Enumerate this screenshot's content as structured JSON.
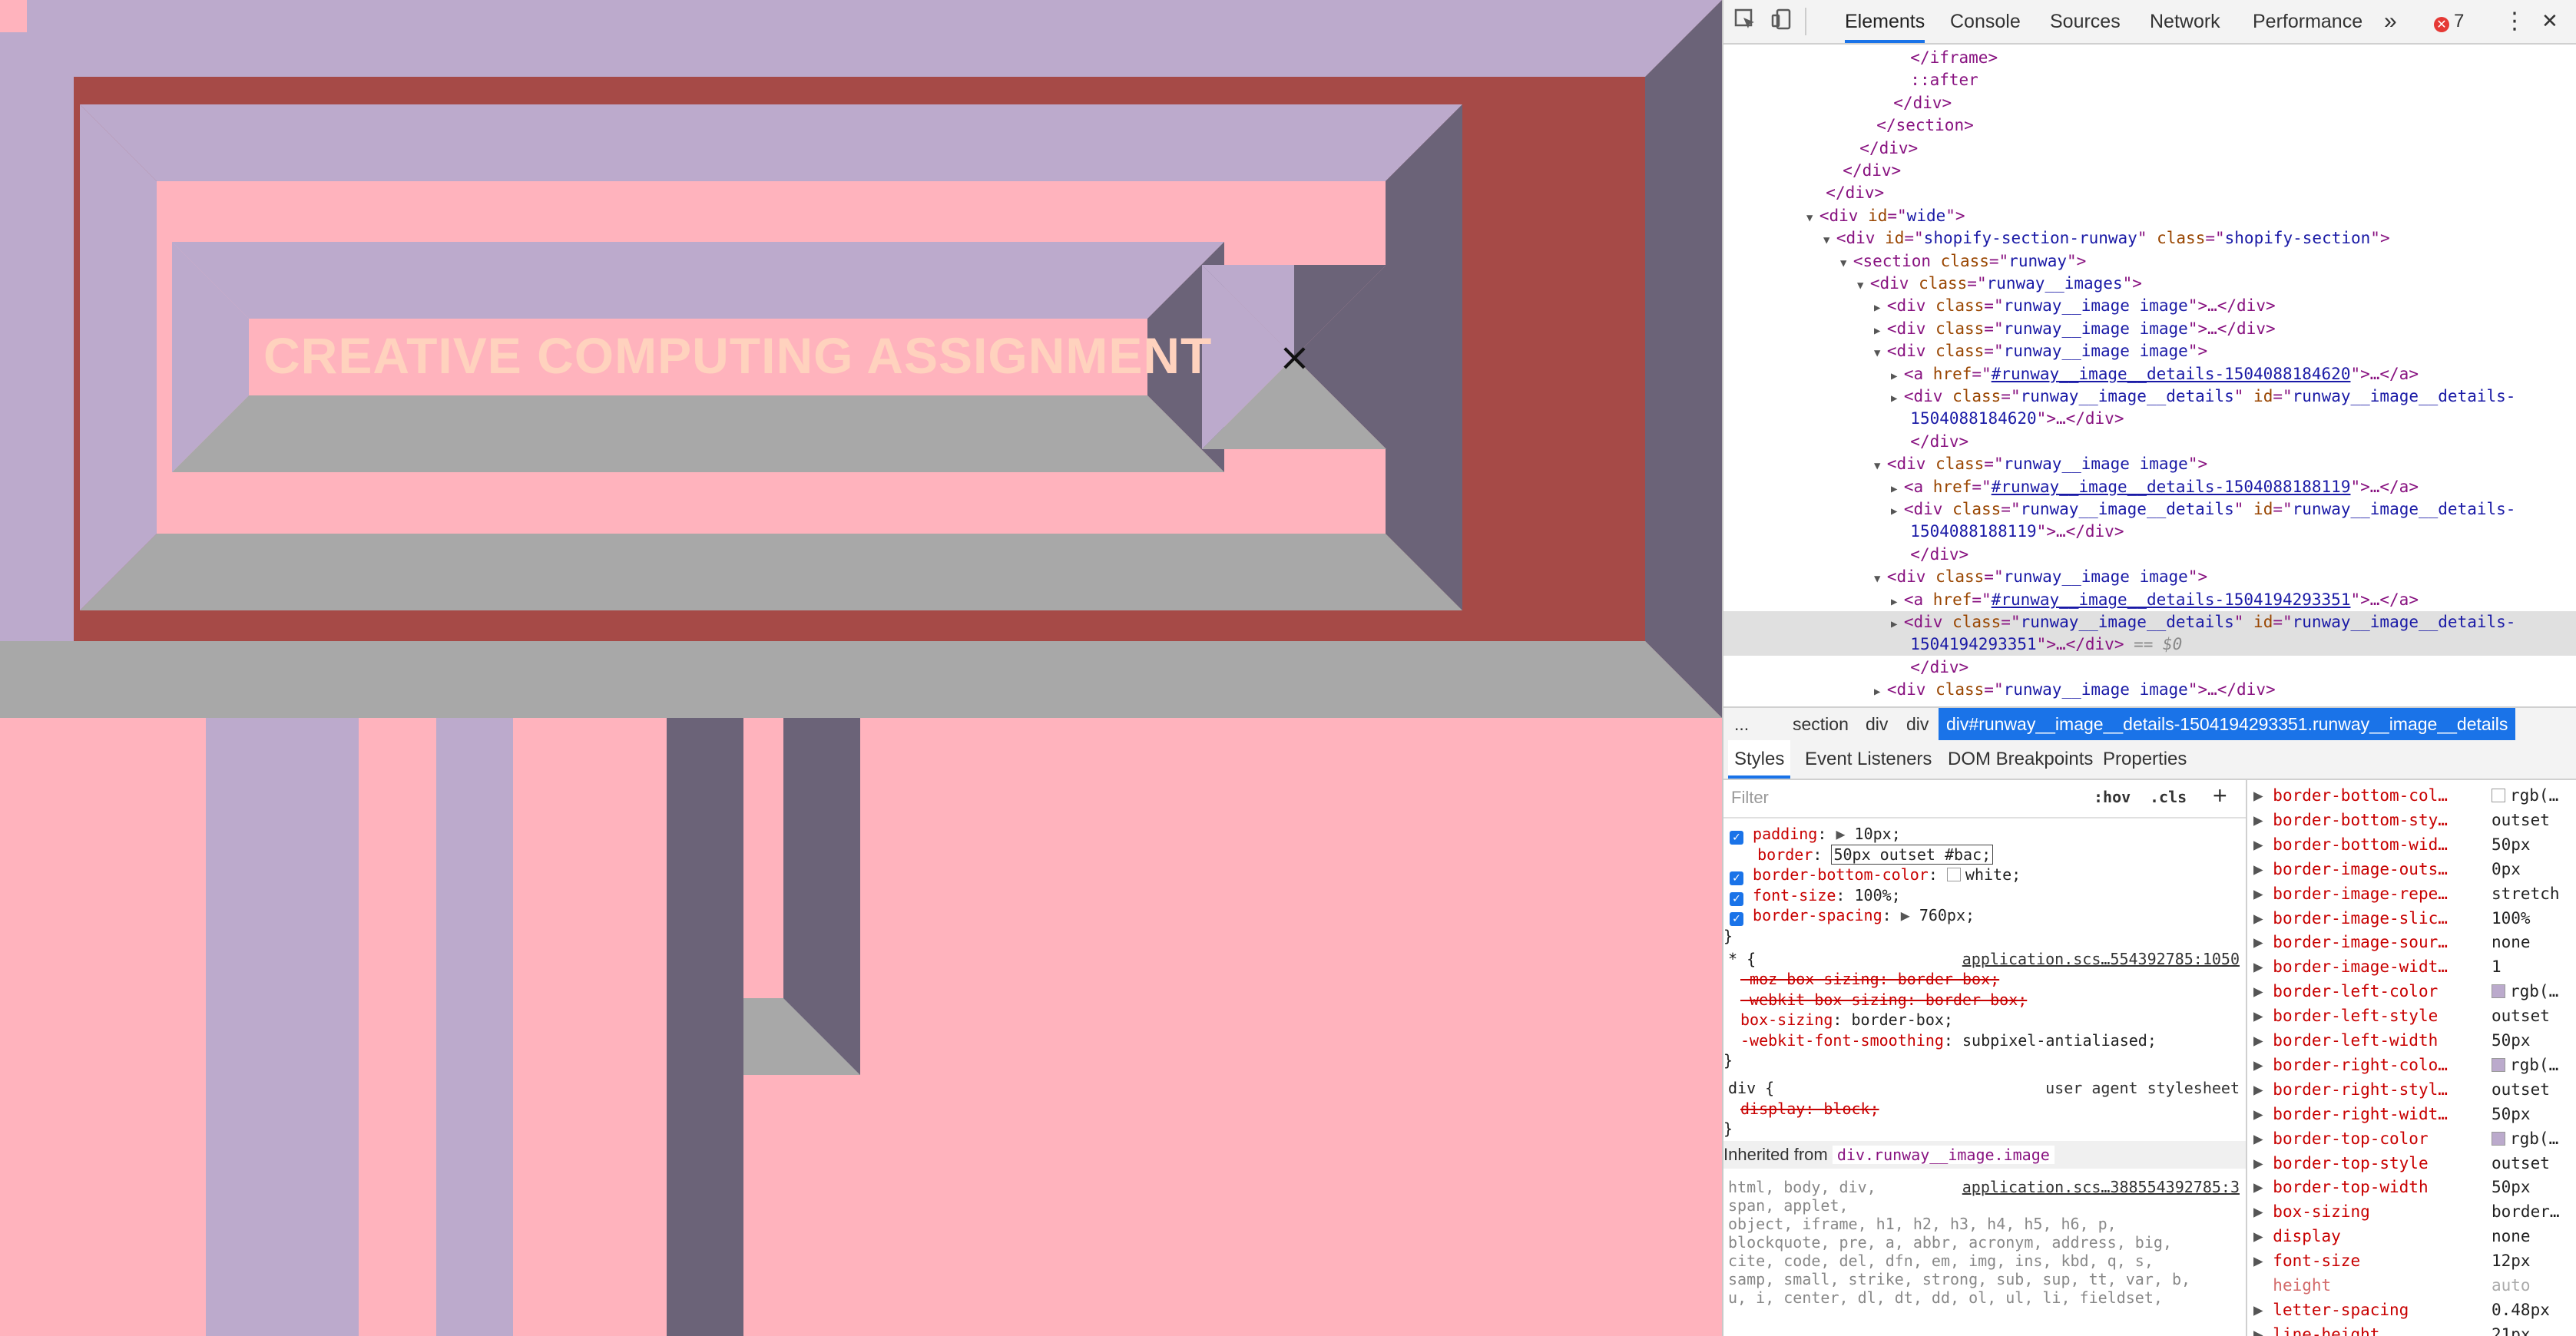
{
  "page": {
    "title": "CREATIVE COMPUTING ASSIGNMENT",
    "close_glyph": "×",
    "colors": {
      "lavender": "#bcaacc",
      "maroon": "#a64a47",
      "pink": "#ffb3bd",
      "gray": "#a8a8a8",
      "slate": "#6b6378",
      "title": "#ffd2be"
    }
  },
  "devtools": {
    "tabs": [
      "Elements",
      "Console",
      "Sources",
      "Network",
      "Performance"
    ],
    "more_tabs": "»",
    "error_count": "7",
    "inspect_icon": "inspect-icon",
    "device_icon": "device-toolbar-icon",
    "menu_glyph": "⋮",
    "close_glyph": "✕",
    "dom_lines": [
      {
        "indent": 10,
        "parts": [
          [
            "tg",
            "</iframe>"
          ]
        ]
      },
      {
        "indent": 10,
        "parts": [
          [
            "tg",
            "::after"
          ]
        ]
      },
      {
        "indent": 8,
        "parts": [
          [
            "tg",
            "</div>"
          ]
        ]
      },
      {
        "indent": 6,
        "parts": [
          [
            "tg",
            "</section>"
          ]
        ]
      },
      {
        "indent": 4,
        "parts": [
          [
            "tg",
            "</div>"
          ]
        ]
      },
      {
        "indent": 2,
        "parts": [
          [
            "tg",
            "</div>"
          ]
        ]
      },
      {
        "indent": 0,
        "parts": [
          [
            "tg",
            "</div>"
          ]
        ]
      },
      {
        "indent": 0,
        "tri": "▼",
        "parts": [
          [
            "tg",
            "<div "
          ],
          [
            "an",
            "id"
          ],
          [
            "tg",
            "=\""
          ],
          [
            "av",
            "wide"
          ],
          [
            "tg",
            "\">"
          ]
        ]
      },
      {
        "indent": 2,
        "tri": "▼",
        "parts": [
          [
            "tg",
            "<div "
          ],
          [
            "an",
            "id"
          ],
          [
            "tg",
            "=\""
          ],
          [
            "av",
            "shopify-section-runway"
          ],
          [
            "tg",
            "\" "
          ],
          [
            "an",
            "class"
          ],
          [
            "tg",
            "=\""
          ],
          [
            "av",
            "shopify-section"
          ],
          [
            "tg",
            "\">"
          ]
        ]
      },
      {
        "indent": 4,
        "tri": "▼",
        "parts": [
          [
            "tg",
            "<section "
          ],
          [
            "an",
            "class"
          ],
          [
            "tg",
            "=\""
          ],
          [
            "av",
            "runway"
          ],
          [
            "tg",
            "\">"
          ]
        ]
      },
      {
        "indent": 6,
        "tri": "▼",
        "parts": [
          [
            "tg",
            "<div "
          ],
          [
            "an",
            "class"
          ],
          [
            "tg",
            "=\""
          ],
          [
            "av",
            "runway__images"
          ],
          [
            "tg",
            "\">"
          ]
        ]
      },
      {
        "indent": 8,
        "tri": "▶",
        "parts": [
          [
            "tg",
            "<div "
          ],
          [
            "an",
            "class"
          ],
          [
            "tg",
            "=\""
          ],
          [
            "av",
            "runway__image image"
          ],
          [
            "tg",
            "\">…</div>"
          ]
        ]
      },
      {
        "indent": 8,
        "tri": "▶",
        "parts": [
          [
            "tg",
            "<div "
          ],
          [
            "an",
            "class"
          ],
          [
            "tg",
            "=\""
          ],
          [
            "av",
            "runway__image image"
          ],
          [
            "tg",
            "\">…</div>"
          ]
        ]
      },
      {
        "indent": 8,
        "tri": "▼",
        "parts": [
          [
            "tg",
            "<div "
          ],
          [
            "an",
            "class"
          ],
          [
            "tg",
            "=\""
          ],
          [
            "av",
            "runway__image image"
          ],
          [
            "tg",
            "\">"
          ]
        ]
      },
      {
        "indent": 10,
        "tri": "▶",
        "parts": [
          [
            "tg",
            "<a "
          ],
          [
            "an",
            "href"
          ],
          [
            "tg",
            "=\""
          ],
          [
            "lk",
            "#runway__image__details-1504088184620"
          ],
          [
            "tg",
            "\">…</a>"
          ]
        ]
      },
      {
        "indent": 10,
        "tri": "▶",
        "parts": [
          [
            "tg",
            "<div "
          ],
          [
            "an",
            "class"
          ],
          [
            "tg",
            "=\""
          ],
          [
            "av",
            "runway__image__details"
          ],
          [
            "tg",
            "\" "
          ],
          [
            "an",
            "id"
          ],
          [
            "tg",
            "=\""
          ],
          [
            "av",
            "runway__image__details-"
          ]
        ]
      },
      {
        "indent": 10,
        "parts": [
          [
            "av",
            "1504088184620"
          ],
          [
            "tg",
            "\">…</div>"
          ]
        ]
      },
      {
        "indent": 10,
        "parts": [
          [
            "tg",
            "</div>"
          ]
        ]
      },
      {
        "indent": 8,
        "tri": "▼",
        "parts": [
          [
            "tg",
            "<div "
          ],
          [
            "an",
            "class"
          ],
          [
            "tg",
            "=\""
          ],
          [
            "av",
            "runway__image image"
          ],
          [
            "tg",
            "\">"
          ]
        ]
      },
      {
        "indent": 10,
        "tri": "▶",
        "parts": [
          [
            "tg",
            "<a "
          ],
          [
            "an",
            "href"
          ],
          [
            "tg",
            "=\""
          ],
          [
            "lk",
            "#runway__image__details-1504088188119"
          ],
          [
            "tg",
            "\">…</a>"
          ]
        ]
      },
      {
        "indent": 10,
        "tri": "▶",
        "parts": [
          [
            "tg",
            "<div "
          ],
          [
            "an",
            "class"
          ],
          [
            "tg",
            "=\""
          ],
          [
            "av",
            "runway__image__details"
          ],
          [
            "tg",
            "\" "
          ],
          [
            "an",
            "id"
          ],
          [
            "tg",
            "=\""
          ],
          [
            "av",
            "runway__image__details-"
          ]
        ]
      },
      {
        "indent": 10,
        "parts": [
          [
            "av",
            "1504088188119"
          ],
          [
            "tg",
            "\">…</div>"
          ]
        ]
      },
      {
        "indent": 10,
        "parts": [
          [
            "tg",
            "</div>"
          ]
        ]
      },
      {
        "indent": 8,
        "tri": "▼",
        "parts": [
          [
            "tg",
            "<div "
          ],
          [
            "an",
            "class"
          ],
          [
            "tg",
            "=\""
          ],
          [
            "av",
            "runway__image image"
          ],
          [
            "tg",
            "\">"
          ]
        ]
      },
      {
        "indent": 10,
        "tri": "▶",
        "parts": [
          [
            "tg",
            "<a "
          ],
          [
            "an",
            "href"
          ],
          [
            "tg",
            "=\""
          ],
          [
            "lk",
            "#runway__image__details-1504194293351"
          ],
          [
            "tg",
            "\">…</a>"
          ]
        ]
      },
      {
        "indent": 10,
        "tri": "▶",
        "sel": true,
        "parts": [
          [
            "tg",
            "<div "
          ],
          [
            "an",
            "class"
          ],
          [
            "tg",
            "=\""
          ],
          [
            "av",
            "runway__image__details"
          ],
          [
            "tg",
            "\" "
          ],
          [
            "an",
            "id"
          ],
          [
            "tg",
            "=\""
          ],
          [
            "av",
            "runway__image__details-"
          ]
        ]
      },
      {
        "indent": 10,
        "sel": true,
        "parts": [
          [
            "av",
            "1504194293351"
          ],
          [
            "tg",
            "\">…</div>"
          ],
          [
            "dollar",
            " == $0"
          ]
        ]
      },
      {
        "indent": 10,
        "parts": [
          [
            "tg",
            "</div>"
          ]
        ]
      },
      {
        "indent": 8,
        "tri": "▶",
        "parts": [
          [
            "tg",
            "<div "
          ],
          [
            "an",
            "class"
          ],
          [
            "tg",
            "=\""
          ],
          [
            "av",
            "runway__image image"
          ],
          [
            "tg",
            "\">…</div>"
          ]
        ]
      }
    ],
    "breadcrumbs": [
      "...",
      "section",
      "div",
      "div",
      "div#runway__image__details-1504194293351.runway__image__details"
    ],
    "subtabs": [
      "Styles",
      "Event Listeners",
      "DOM Breakpoints",
      "Properties"
    ],
    "filter_placeholder": "Filter",
    "hov": ":hov",
    "cls": ".cls",
    "rule1": [
      {
        "check": true,
        "name": "padding",
        "arrow": true,
        "value": "10px;"
      },
      {
        "check": false,
        "name": "border",
        "value": "50px outset #bac;",
        "editing": true
      },
      {
        "check": true,
        "name": "border-bottom-color",
        "swatch": "#ffffff",
        "value": "white;"
      },
      {
        "check": true,
        "name": "font-size",
        "value": "100%;"
      },
      {
        "check": true,
        "name": "border-spacing",
        "arrow": true,
        "value": "760px;"
      }
    ],
    "rule2_selector": "* {",
    "rule2_source": "application.scs…554392785:1050",
    "rule2": [
      {
        "strike": true,
        "text": "-moz-box-sizing: border-box;"
      },
      {
        "strike": true,
        "text": "-webkit-box-sizing: border-box;"
      },
      {
        "name": "box-sizing",
        "value": "border-box;"
      },
      {
        "name": "-webkit-font-smoothing",
        "value": "subpixel-antialiased;"
      }
    ],
    "rule3_selector": "div {",
    "rule3_source": "user agent stylesheet",
    "rule3": [
      {
        "strike": true,
        "text": "display: block;"
      }
    ],
    "close_brace": "}",
    "inherited_label": "Inherited from",
    "inherited_tag": "div.runway__image.image",
    "rule4_source": "application.scs…388554392785:3",
    "rule4_lines": [
      "html, body, div,",
      "span, applet,",
      "object, iframe, h1, h2, h3, h4, h5, h6, p,",
      "blockquote, pre, a, abbr, acronym, address, big,",
      "cite, code, del, dfn, em, img, ins, kbd, q, s,",
      "samp, small, strike, strong, sub, sup, tt, var, b,",
      "u, i, center, dl, dt, dd, ol, ul, li, fieldset,"
    ],
    "computed": [
      {
        "k": "border-bottom-col…",
        "v": "rgb(…",
        "swatch": "#ffffff"
      },
      {
        "k": "border-bottom-sty…",
        "v": "outset"
      },
      {
        "k": "border-bottom-wid…",
        "v": "50px"
      },
      {
        "k": "border-image-outs…",
        "v": "0px"
      },
      {
        "k": "border-image-repe…",
        "v": "stretch"
      },
      {
        "k": "border-image-slic…",
        "v": "100%"
      },
      {
        "k": "border-image-sour…",
        "v": "none"
      },
      {
        "k": "border-image-widt…",
        "v": "1"
      },
      {
        "k": "border-left-color",
        "v": "rgb(…",
        "swatch": "#bbaacc"
      },
      {
        "k": "border-left-style",
        "v": "outset"
      },
      {
        "k": "border-left-width",
        "v": "50px"
      },
      {
        "k": "border-right-colo…",
        "v": "rgb(…",
        "swatch": "#bbaacc"
      },
      {
        "k": "border-right-styl…",
        "v": "outset"
      },
      {
        "k": "border-right-widt…",
        "v": "50px"
      },
      {
        "k": "border-top-color",
        "v": "rgb(…",
        "swatch": "#bbaacc"
      },
      {
        "k": "border-top-style",
        "v": "outset"
      },
      {
        "k": "border-top-width",
        "v": "50px"
      },
      {
        "k": "box-sizing",
        "v": "border…"
      },
      {
        "k": "display",
        "v": "none"
      },
      {
        "k": "font-size",
        "v": "12px"
      },
      {
        "k": "height",
        "v": "auto",
        "dim": true
      },
      {
        "k": "letter-spacing",
        "v": "0.48px"
      },
      {
        "k": "line-height",
        "v": "21px"
      }
    ]
  }
}
